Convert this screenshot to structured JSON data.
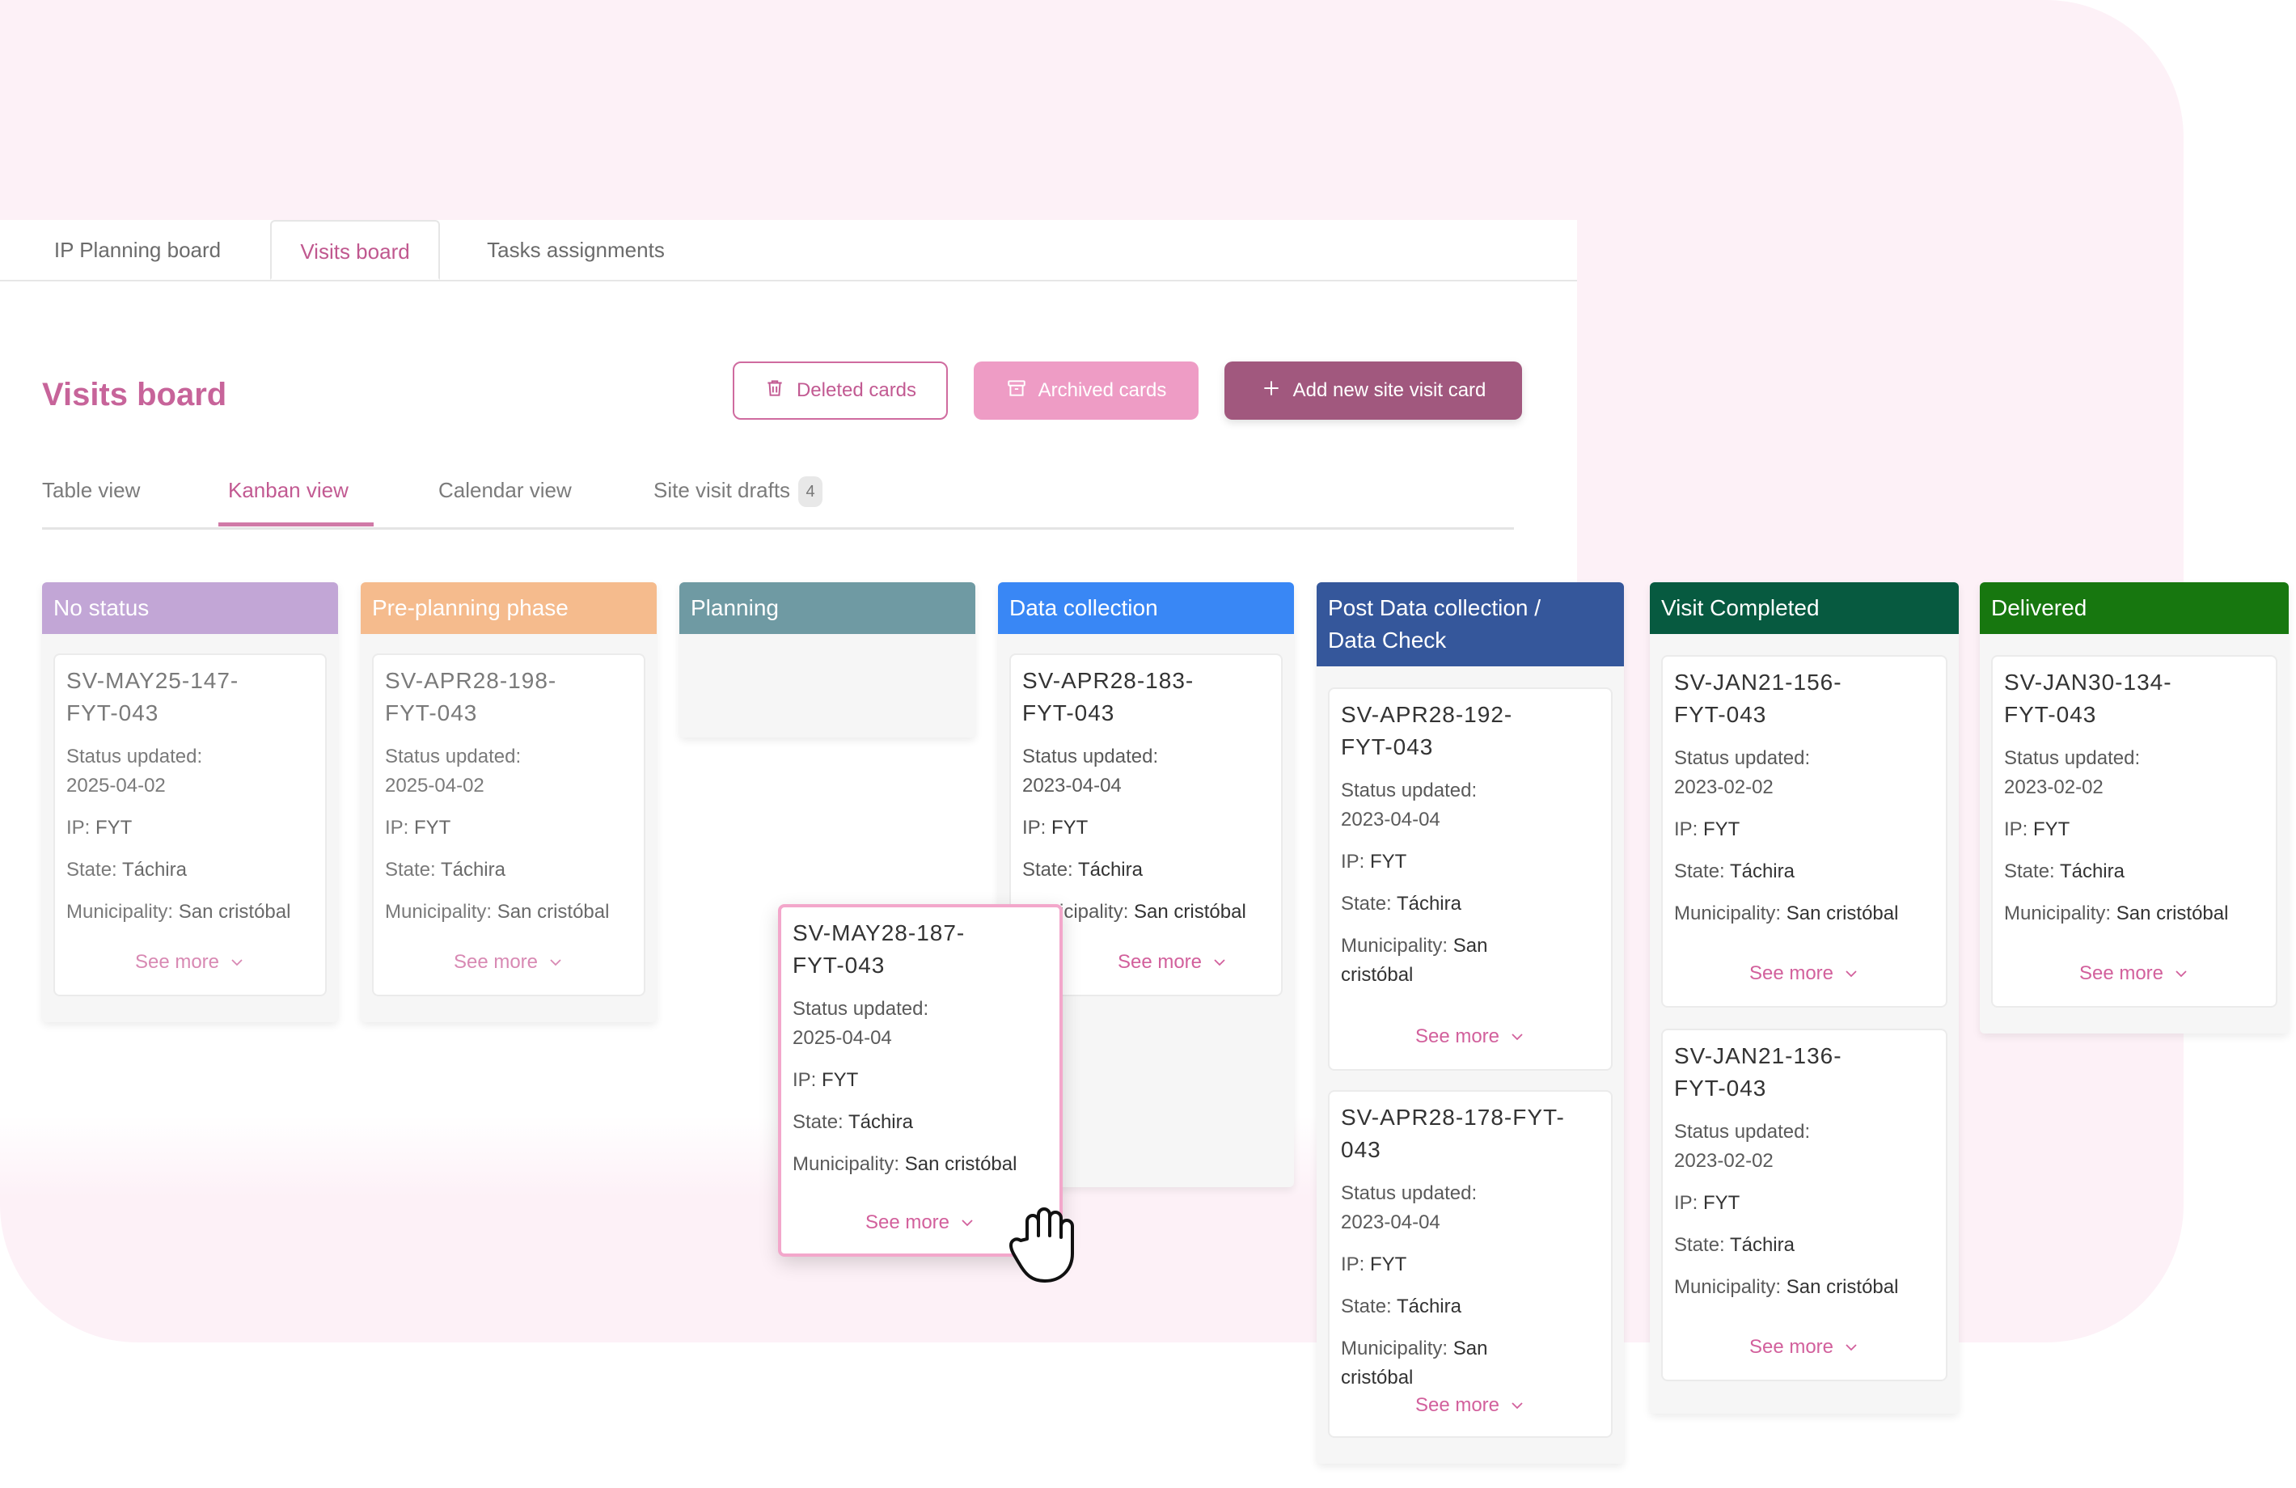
{
  "top_tabs": [
    {
      "label": "IP Planning board"
    },
    {
      "label": "Visits board"
    },
    {
      "label": "Tasks assignments"
    }
  ],
  "page_title": "Visits board",
  "buttons": {
    "deleted": "Deleted cards",
    "archived": "Archived cards",
    "add": "Add new site visit card"
  },
  "view_tabs": [
    {
      "label": "Table view"
    },
    {
      "label": "Kanban view"
    },
    {
      "label": "Calendar view"
    },
    {
      "label": "Site visit drafts",
      "badge": "4"
    }
  ],
  "colors": {
    "no_status": "#c2a6d6",
    "pre_planning": "#f5bb8d",
    "planning": "#6f9aa3",
    "data_collection": "#3987f5",
    "post_data": "#35579b",
    "visit_completed": "#075a40",
    "delivered": "#17770f",
    "accent": "#c25a92"
  },
  "labels": {
    "status_updated": "Status updated:",
    "ip": "IP:",
    "state": "State:",
    "municipality": "Municipality:",
    "see_more": "See more"
  },
  "columns": [
    {
      "title": "No status",
      "cards": [
        {
          "id_line1": "SV-MAY25-147-",
          "id_line2": "FYT-043",
          "date": "2025-04-02",
          "ip": "FYT",
          "state": "Táchira",
          "municipality": "San cristóbal"
        }
      ]
    },
    {
      "title": "Pre-planning phase",
      "cards": [
        {
          "id_line1": "SV-APR28-198-",
          "id_line2": "FYT-043",
          "date": "2025-04-02",
          "ip": "FYT",
          "state": "Táchira",
          "municipality": "San cristóbal"
        }
      ]
    },
    {
      "title": "Planning",
      "cards": []
    },
    {
      "title": "Data collection",
      "cards": [
        {
          "id_line1": "SV-APR28-183-",
          "id_line2": "FYT-043",
          "date": "2023-04-04",
          "ip": "FYT",
          "state": "Táchira",
          "municipality_partial": "icipality:",
          "municipality": "San cristóbal"
        }
      ]
    },
    {
      "title_line1": "Post Data collection /",
      "title_line2": "Data Check",
      "cards": [
        {
          "id_line1": "SV-APR28-192-",
          "id_line2": "FYT-043",
          "date": "2023-04-04",
          "ip": "FYT",
          "state": "Táchira",
          "municipality_line1": "San",
          "municipality_line2": "cristóbal"
        },
        {
          "id_line1": "SV-APR28-178-FYT-043",
          "date": "2023-04-04",
          "ip": "FYT",
          "state": "Táchira",
          "municipality_line1": "San",
          "municipality_line2": "cristóbal"
        }
      ]
    },
    {
      "title": "Visit Completed",
      "cards": [
        {
          "id_line1": "SV-JAN21-156-",
          "id_line2": "FYT-043",
          "date": "2023-02-02",
          "ip": "FYT",
          "state": "Táchira",
          "municipality": "San cristóbal"
        },
        {
          "id_line1": "SV-JAN21-136-",
          "id_line2": "FYT-043",
          "date": "2023-02-02",
          "ip": "FYT",
          "state": "Táchira",
          "municipality": "San cristóbal"
        }
      ]
    },
    {
      "title": "Delivered",
      "cards": [
        {
          "id_line1": "SV-JAN30-134-",
          "id_line2": "FYT-043",
          "date": "2023-02-02",
          "ip": "FYT",
          "state": "Táchira",
          "municipality": "San cristóbal"
        }
      ]
    }
  ],
  "drag_card": {
    "id_line1": "SV-MAY28-187-",
    "id_line2": "FYT-043",
    "date": "2025-04-04",
    "ip": "FYT",
    "state": "Táchira",
    "municipality": "San cristóbal"
  },
  "icons": {
    "deleted": "trash-icon",
    "archived": "archive-box-icon",
    "add": "plus-icon",
    "see_more": "chevron-down-icon",
    "cursor": "hand-grab-cursor-icon"
  }
}
